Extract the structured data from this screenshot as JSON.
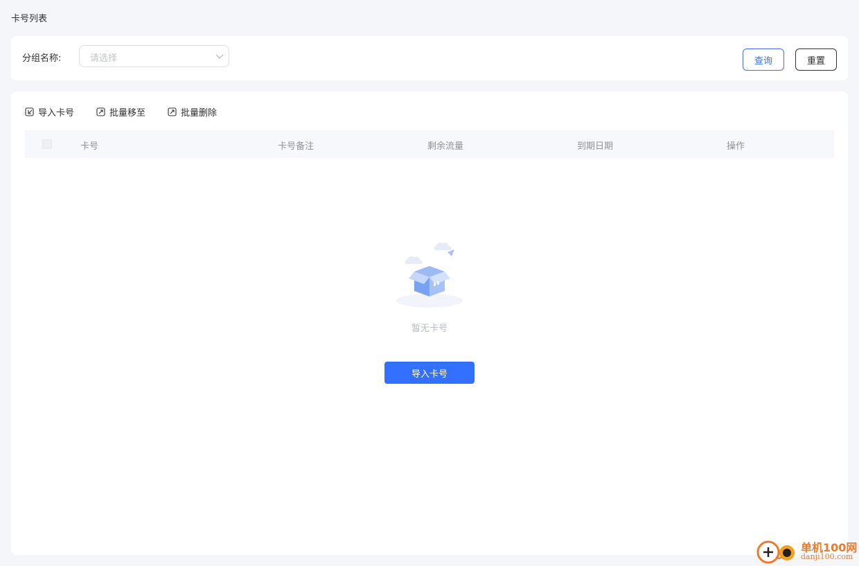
{
  "page": {
    "title": "卡号列表"
  },
  "filter": {
    "group_label": "分组名称:",
    "group_placeholder": "请选择",
    "query_label": "查询",
    "reset_label": "重置"
  },
  "toolbar": {
    "import_label": "导入卡号",
    "batch_move_label": "批量移至",
    "batch_delete_label": "批量删除"
  },
  "table": {
    "columns": [
      "卡号",
      "卡号备注",
      "剩余流量",
      "到期日期",
      "操作"
    ],
    "rows": []
  },
  "empty": {
    "message": "暂无卡号",
    "import_button": "导入卡号"
  },
  "watermark": {
    "name": "单机100网",
    "domain": "danji100.com"
  },
  "colors": {
    "primary": "#3370ff",
    "background": "#f5f6fa",
    "watermark": "#f07a2b"
  }
}
